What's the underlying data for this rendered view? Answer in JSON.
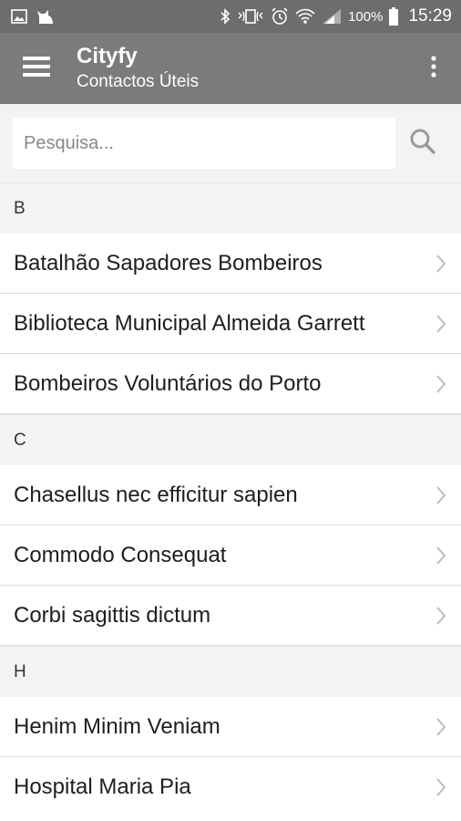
{
  "status_bar": {
    "left_icons": [
      "image-icon",
      "cat-icon"
    ],
    "right_icons": [
      "bluetooth-icon",
      "vibrate-icon",
      "alarm-icon",
      "wifi-icon",
      "signal-icon",
      "battery-icon"
    ],
    "battery": "100%",
    "time": "15:29"
  },
  "app_bar": {
    "title": "Cityfy",
    "subtitle": "Contactos Úteis",
    "menu_icon": "hamburger-menu-icon",
    "overflow_icon": "more-vert-icon",
    "background": "#7b7b7b"
  },
  "search": {
    "placeholder": "Pesquisa...",
    "value": "",
    "icon": "search-icon"
  },
  "sections": [
    {
      "letter": "B",
      "items": [
        {
          "label": "Batalhão Sapadores Bombeiros"
        },
        {
          "label": "Biblioteca Municipal Almeida Garrett"
        },
        {
          "label": "Bombeiros Voluntários do Porto"
        }
      ]
    },
    {
      "letter": "C",
      "items": [
        {
          "label": "Chasellus nec efficitur sapien"
        },
        {
          "label": "Commodo Consequat"
        },
        {
          "label": "Corbi sagittis dictum"
        }
      ]
    },
    {
      "letter": "H",
      "items": [
        {
          "label": "Henim Minim Veniam"
        },
        {
          "label": "Hospital Maria Pia"
        }
      ]
    }
  ]
}
